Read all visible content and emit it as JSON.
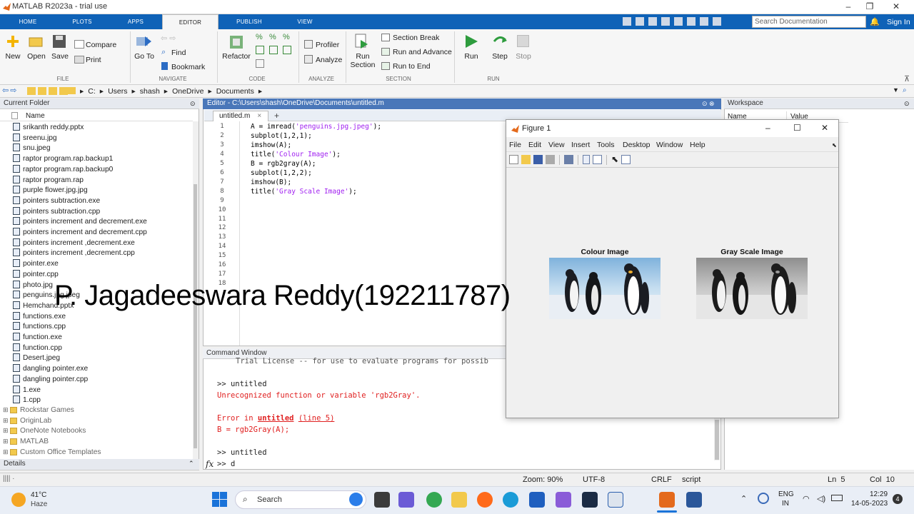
{
  "window": {
    "title": "MATLAB R2023a - trial use"
  },
  "tabs": [
    "HOME",
    "PLOTS",
    "APPS",
    "EDITOR",
    "PUBLISH",
    "VIEW"
  ],
  "search": {
    "placeholder": "Search Documentation",
    "signin": "Sign In"
  },
  "toolstrip": {
    "file": {
      "new": "New",
      "open": "Open",
      "save": "Save",
      "compare": "Compare",
      "print": "Print",
      "label": "FILE"
    },
    "navigate": {
      "goto_line1": "Go To",
      "find": "Find",
      "bookmark": "Bookmark",
      "label": "NAVIGATE"
    },
    "code": {
      "refactor": "Refactor",
      "label": "CODE"
    },
    "analyze": {
      "profiler": "Profiler",
      "analyze": "Analyze",
      "label": "ANALYZE"
    },
    "section": {
      "run_section_1": "Run",
      "run_section_2": "Section",
      "section_break": "Section Break",
      "run_advance": "Run and Advance",
      "run_end": "Run to End",
      "label": "SECTION"
    },
    "run": {
      "run": "Run",
      "step": "Step",
      "stop": "Stop",
      "label": "RUN"
    }
  },
  "address": {
    "crumbs": [
      "C:",
      "Users",
      "shash",
      "OneDrive",
      "Documents"
    ]
  },
  "current_folder": {
    "title": "Current Folder",
    "column": "Name",
    "files": [
      "srikanth reddy.pptx",
      "sreenu.jpg",
      "snu.jpeg",
      "raptor program.rap.backup1",
      "raptor program.rap.backup0",
      "raptor program.rap",
      "purple flower.jpg.jpg",
      "pointers subtraction.exe",
      "pointers subtraction.cpp",
      "pointers increment and decrement.exe",
      "pointers increment and decrement.cpp",
      "pointers increment ,decrement.exe",
      "pointers increment ,decrement.cpp",
      "pointer.exe",
      "pointer.cpp",
      "photo.jpg",
      "penguins.jpg.jpeg",
      "Hemchand.pptx",
      "functions.exe",
      "functions.cpp",
      "function.exe",
      "function.cpp",
      "Desert.jpeg",
      "dangling pointer.exe",
      "dangling pointer.cpp",
      "1.exe",
      "1.cpp"
    ],
    "folders": [
      "Rockstar Games",
      "OriginLab",
      "OneNote Notebooks",
      "MATLAB",
      "Custom Office Templates"
    ],
    "details": "Details"
  },
  "editor": {
    "header": "Editor - C:\\Users\\shash\\OneDrive\\Documents\\untitled.m",
    "tab": "untitled.m",
    "lines": [
      {
        "pre": "A = imread(",
        "str": "'penguins.jpg.jpeg'",
        "post": ");"
      },
      {
        "pre": "subplot(1,2,1);",
        "str": "",
        "post": ""
      },
      {
        "pre": "imshow(A);",
        "str": "",
        "post": ""
      },
      {
        "pre": "title(",
        "str": "'Colour Image'",
        "post": ");"
      },
      {
        "pre": "B = rgb2gray(A);",
        "str": "",
        "post": ""
      },
      {
        "pre": "subplot(1,2,2);",
        "str": "",
        "post": ""
      },
      {
        "pre": "imshow(B);",
        "str": "",
        "post": ""
      },
      {
        "pre": "title(",
        "str": "'Gray Scale Image'",
        "post": ");"
      }
    ],
    "line_numbers": [
      "1",
      "2",
      "3",
      "4",
      "5",
      "6",
      "7",
      "8",
      "9",
      "10",
      "11",
      "12",
      "13",
      "14",
      "15",
      "16",
      "17",
      "18"
    ]
  },
  "command_window": {
    "title": "Command Window",
    "trial": "Trial License -- for use to evaluate programs for possib",
    "cmd1": ">> untitled",
    "err1": "Unrecognized function or variable 'rgb2Gray'.",
    "err2_pre": "Error in ",
    "err2_link": "untitled",
    "err2_line": "(line 5)",
    "err3": "B = rgb2Gray(A);",
    "cmd2": ">> untitled",
    "prompt": ">> d"
  },
  "workspace": {
    "title": "Workspace",
    "col_name": "Name",
    "col_value": "Value"
  },
  "figure": {
    "title": "Figure 1",
    "menu": [
      "File",
      "Edit",
      "View",
      "Insert",
      "Tools",
      "Desktop",
      "Window",
      "Help"
    ],
    "ax1": "Colour Image",
    "ax2": "Gray Scale Image"
  },
  "overlay_text": "P. Jagadeeswara Reddy(192211787)",
  "status": {
    "zoom": "Zoom: 90%",
    "encoding": "UTF-8",
    "eol": "CRLF",
    "type": "script",
    "ln": "Ln  5",
    "col": "Col  10"
  },
  "taskbar": {
    "weather_temp": "41°C",
    "weather_desc": "Haze",
    "search": "Search",
    "lang1": "ENG",
    "lang2": "IN",
    "time": "12:29",
    "date": "14-05-2023",
    "badge": "4"
  },
  "colors": {
    "accent": "#0f62b7",
    "editor_header": "#4a77b9",
    "error": "#e02020",
    "string": "#a020f0"
  }
}
